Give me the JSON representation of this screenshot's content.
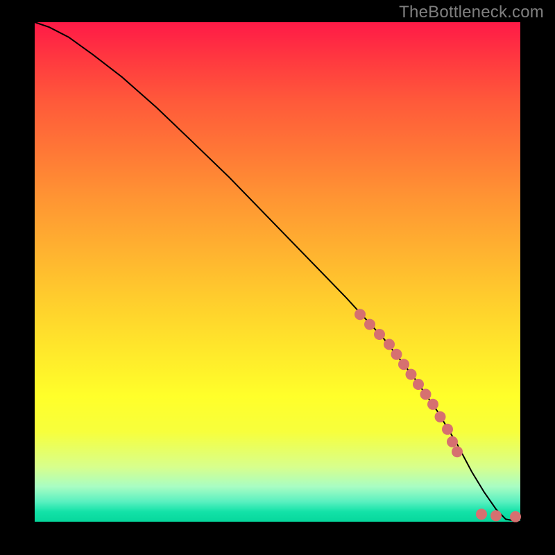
{
  "watermark": "TheBottleneck.com",
  "colors": {
    "background_frame": "#000000",
    "line": "#000000",
    "marker_fill": "#d67070",
    "marker_stroke": "#8a3a3a",
    "watermark": "#7f7f7f"
  },
  "chart_data": {
    "type": "line",
    "title": "",
    "xlabel": "",
    "ylabel": "",
    "xlim": [
      0,
      100
    ],
    "ylim": [
      0,
      100
    ],
    "grid": false,
    "legend": false,
    "background": "vertical-gradient red→yellow→green",
    "series": [
      {
        "name": "curve",
        "style": "solid",
        "color": "#000000",
        "x": [
          0,
          3,
          7,
          12,
          18,
          25,
          32,
          40,
          48,
          56,
          64,
          72,
          78,
          83,
          87,
          90,
          92.5,
          95,
          97,
          100
        ],
        "y": [
          100,
          99,
          97,
          93.5,
          89,
          83,
          76.5,
          69,
          61,
          53,
          45,
          36.5,
          29,
          22,
          15.5,
          10,
          6,
          2.5,
          0.5,
          0
        ]
      },
      {
        "name": "markers",
        "style": "points",
        "color": "#d67070",
        "x": [
          67,
          69,
          71,
          73,
          74.5,
          76,
          77.5,
          79,
          80.5,
          82,
          83.5,
          85,
          86,
          87,
          92,
          95,
          99
        ],
        "y": [
          41.5,
          39.5,
          37.5,
          35.5,
          33.5,
          31.5,
          29.5,
          27.5,
          25.5,
          23.5,
          21,
          18.5,
          16,
          14,
          1.5,
          1.2,
          1.0
        ]
      }
    ]
  }
}
